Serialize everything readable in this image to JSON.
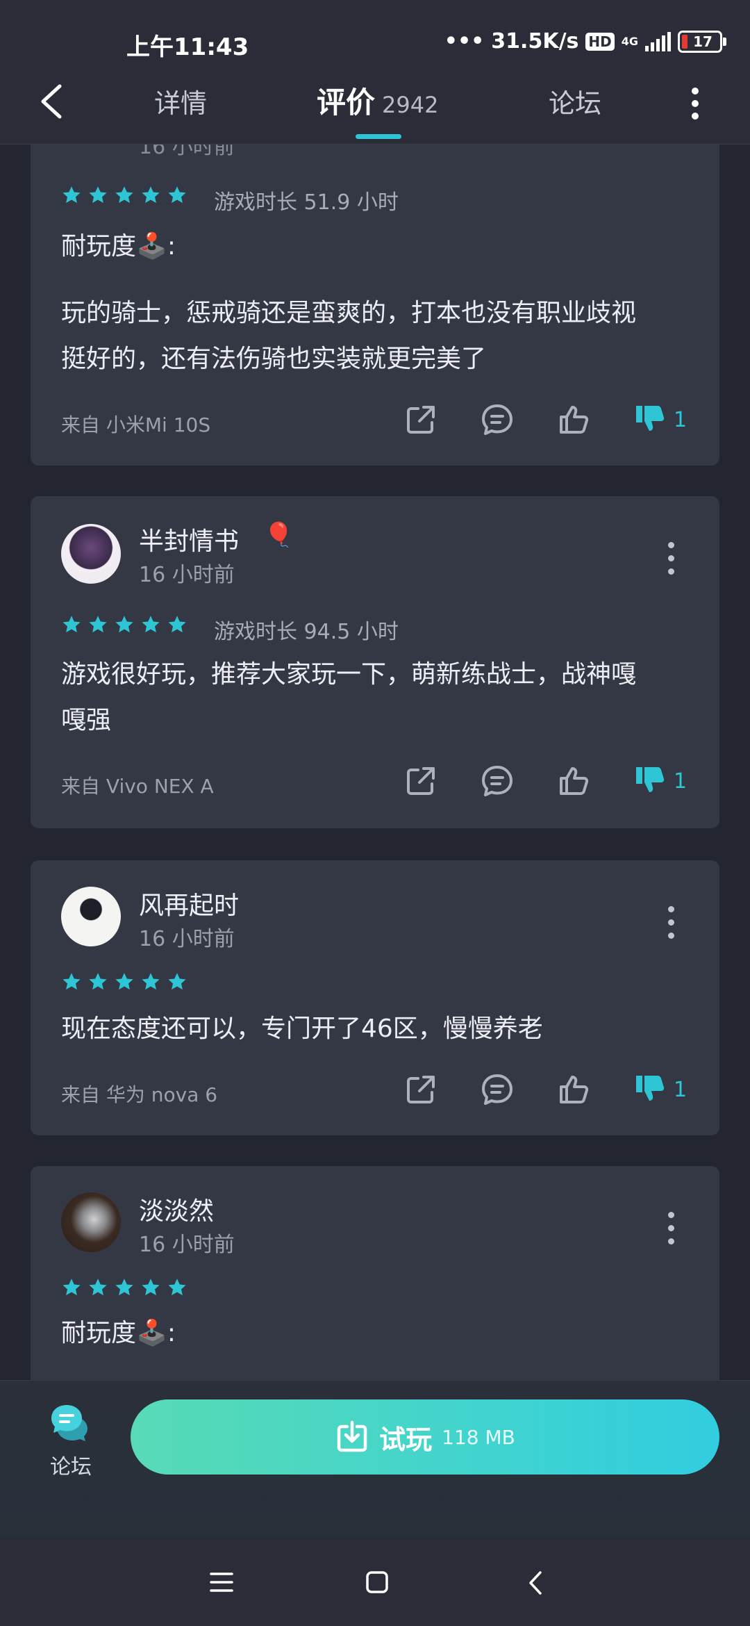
{
  "status_bar": {
    "time": "上午11:43",
    "net_speed": "31.5K/s",
    "hd": "HD",
    "network": "4G",
    "battery": "17"
  },
  "header": {
    "tabs": [
      {
        "label": "详情"
      },
      {
        "label": "评价",
        "count": "2942"
      },
      {
        "label": "论坛"
      }
    ]
  },
  "reviews": [
    {
      "time": "16 小时前",
      "stars": 5,
      "playtime": "游戏时长 51.9 小时",
      "content_lines": [
        "耐玩度🕹️:",
        "玩的骑士，惩戒骑还是蛮爽的，打本也没有职业歧视",
        "挺好的，还有法伤骑也实装就更完美了"
      ],
      "device": "来自 小米Mi 10S",
      "dislikes": "1"
    },
    {
      "username": "半封情书",
      "badge": "🎈",
      "time": "16 小时前",
      "stars": 5,
      "playtime": "游戏时长 94.5 小时",
      "content_lines": [
        "游戏很好玩，推荐大家玩一下，萌新练战士，战神嘎",
        "嘎强"
      ],
      "device": "来自 Vivo NEX A",
      "dislikes": "1"
    },
    {
      "username": "风再起时",
      "time": "16 小时前",
      "stars": 5,
      "content_lines": [
        "现在态度还可以，专门开了46区，慢慢养老"
      ],
      "device": "来自 华为 nova 6",
      "dislikes": "1"
    },
    {
      "username": "淡淡然",
      "time": "16 小时前",
      "stars": 5,
      "content_lines": [
        "耐玩度🕹️:"
      ]
    }
  ],
  "bottom": {
    "forum_label": "论坛",
    "trial_label": "试玩",
    "trial_size": "118 MB"
  },
  "colors": {
    "accent": "#2ec6d4",
    "card": "#343844",
    "background": "#232630"
  },
  "icons": [
    "back-icon",
    "more-icon",
    "share-icon",
    "comment-icon",
    "thumbs-up-icon",
    "thumbs-down-icon",
    "star-icon",
    "forum-icon",
    "download-icon",
    "menu-icon",
    "home-icon",
    "nav-back-icon"
  ]
}
